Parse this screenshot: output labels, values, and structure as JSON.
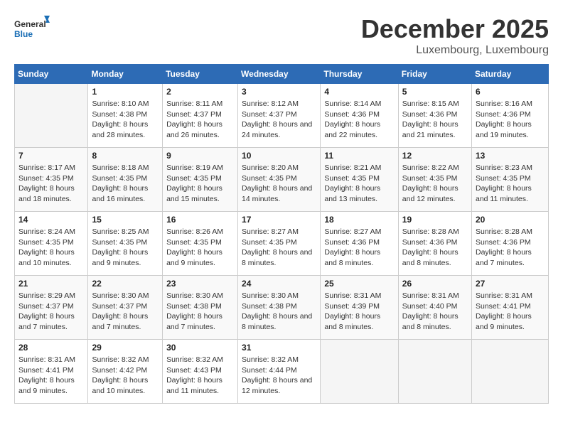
{
  "logo": {
    "line1": "General",
    "line2": "Blue"
  },
  "title": "December 2025",
  "subtitle": "Luxembourg, Luxembourg",
  "days_of_week": [
    "Sunday",
    "Monday",
    "Tuesday",
    "Wednesday",
    "Thursday",
    "Friday",
    "Saturday"
  ],
  "weeks": [
    [
      {
        "day": "",
        "sunrise": "",
        "sunset": "",
        "daylight": ""
      },
      {
        "day": "1",
        "sunrise": "Sunrise: 8:10 AM",
        "sunset": "Sunset: 4:38 PM",
        "daylight": "Daylight: 8 hours and 28 minutes."
      },
      {
        "day": "2",
        "sunrise": "Sunrise: 8:11 AM",
        "sunset": "Sunset: 4:37 PM",
        "daylight": "Daylight: 8 hours and 26 minutes."
      },
      {
        "day": "3",
        "sunrise": "Sunrise: 8:12 AM",
        "sunset": "Sunset: 4:37 PM",
        "daylight": "Daylight: 8 hours and 24 minutes."
      },
      {
        "day": "4",
        "sunrise": "Sunrise: 8:14 AM",
        "sunset": "Sunset: 4:36 PM",
        "daylight": "Daylight: 8 hours and 22 minutes."
      },
      {
        "day": "5",
        "sunrise": "Sunrise: 8:15 AM",
        "sunset": "Sunset: 4:36 PM",
        "daylight": "Daylight: 8 hours and 21 minutes."
      },
      {
        "day": "6",
        "sunrise": "Sunrise: 8:16 AM",
        "sunset": "Sunset: 4:36 PM",
        "daylight": "Daylight: 8 hours and 19 minutes."
      }
    ],
    [
      {
        "day": "7",
        "sunrise": "Sunrise: 8:17 AM",
        "sunset": "Sunset: 4:35 PM",
        "daylight": "Daylight: 8 hours and 18 minutes."
      },
      {
        "day": "8",
        "sunrise": "Sunrise: 8:18 AM",
        "sunset": "Sunset: 4:35 PM",
        "daylight": "Daylight: 8 hours and 16 minutes."
      },
      {
        "day": "9",
        "sunrise": "Sunrise: 8:19 AM",
        "sunset": "Sunset: 4:35 PM",
        "daylight": "Daylight: 8 hours and 15 minutes."
      },
      {
        "day": "10",
        "sunrise": "Sunrise: 8:20 AM",
        "sunset": "Sunset: 4:35 PM",
        "daylight": "Daylight: 8 hours and 14 minutes."
      },
      {
        "day": "11",
        "sunrise": "Sunrise: 8:21 AM",
        "sunset": "Sunset: 4:35 PM",
        "daylight": "Daylight: 8 hours and 13 minutes."
      },
      {
        "day": "12",
        "sunrise": "Sunrise: 8:22 AM",
        "sunset": "Sunset: 4:35 PM",
        "daylight": "Daylight: 8 hours and 12 minutes."
      },
      {
        "day": "13",
        "sunrise": "Sunrise: 8:23 AM",
        "sunset": "Sunset: 4:35 PM",
        "daylight": "Daylight: 8 hours and 11 minutes."
      }
    ],
    [
      {
        "day": "14",
        "sunrise": "Sunrise: 8:24 AM",
        "sunset": "Sunset: 4:35 PM",
        "daylight": "Daylight: 8 hours and 10 minutes."
      },
      {
        "day": "15",
        "sunrise": "Sunrise: 8:25 AM",
        "sunset": "Sunset: 4:35 PM",
        "daylight": "Daylight: 8 hours and 9 minutes."
      },
      {
        "day": "16",
        "sunrise": "Sunrise: 8:26 AM",
        "sunset": "Sunset: 4:35 PM",
        "daylight": "Daylight: 8 hours and 9 minutes."
      },
      {
        "day": "17",
        "sunrise": "Sunrise: 8:27 AM",
        "sunset": "Sunset: 4:35 PM",
        "daylight": "Daylight: 8 hours and 8 minutes."
      },
      {
        "day": "18",
        "sunrise": "Sunrise: 8:27 AM",
        "sunset": "Sunset: 4:36 PM",
        "daylight": "Daylight: 8 hours and 8 minutes."
      },
      {
        "day": "19",
        "sunrise": "Sunrise: 8:28 AM",
        "sunset": "Sunset: 4:36 PM",
        "daylight": "Daylight: 8 hours and 8 minutes."
      },
      {
        "day": "20",
        "sunrise": "Sunrise: 8:28 AM",
        "sunset": "Sunset: 4:36 PM",
        "daylight": "Daylight: 8 hours and 7 minutes."
      }
    ],
    [
      {
        "day": "21",
        "sunrise": "Sunrise: 8:29 AM",
        "sunset": "Sunset: 4:37 PM",
        "daylight": "Daylight: 8 hours and 7 minutes."
      },
      {
        "day": "22",
        "sunrise": "Sunrise: 8:30 AM",
        "sunset": "Sunset: 4:37 PM",
        "daylight": "Daylight: 8 hours and 7 minutes."
      },
      {
        "day": "23",
        "sunrise": "Sunrise: 8:30 AM",
        "sunset": "Sunset: 4:38 PM",
        "daylight": "Daylight: 8 hours and 7 minutes."
      },
      {
        "day": "24",
        "sunrise": "Sunrise: 8:30 AM",
        "sunset": "Sunset: 4:38 PM",
        "daylight": "Daylight: 8 hours and 8 minutes."
      },
      {
        "day": "25",
        "sunrise": "Sunrise: 8:31 AM",
        "sunset": "Sunset: 4:39 PM",
        "daylight": "Daylight: 8 hours and 8 minutes."
      },
      {
        "day": "26",
        "sunrise": "Sunrise: 8:31 AM",
        "sunset": "Sunset: 4:40 PM",
        "daylight": "Daylight: 8 hours and 8 minutes."
      },
      {
        "day": "27",
        "sunrise": "Sunrise: 8:31 AM",
        "sunset": "Sunset: 4:41 PM",
        "daylight": "Daylight: 8 hours and 9 minutes."
      }
    ],
    [
      {
        "day": "28",
        "sunrise": "Sunrise: 8:31 AM",
        "sunset": "Sunset: 4:41 PM",
        "daylight": "Daylight: 8 hours and 9 minutes."
      },
      {
        "day": "29",
        "sunrise": "Sunrise: 8:32 AM",
        "sunset": "Sunset: 4:42 PM",
        "daylight": "Daylight: 8 hours and 10 minutes."
      },
      {
        "day": "30",
        "sunrise": "Sunrise: 8:32 AM",
        "sunset": "Sunset: 4:43 PM",
        "daylight": "Daylight: 8 hours and 11 minutes."
      },
      {
        "day": "31",
        "sunrise": "Sunrise: 8:32 AM",
        "sunset": "Sunset: 4:44 PM",
        "daylight": "Daylight: 8 hours and 12 minutes."
      },
      {
        "day": "",
        "sunrise": "",
        "sunset": "",
        "daylight": ""
      },
      {
        "day": "",
        "sunrise": "",
        "sunset": "",
        "daylight": ""
      },
      {
        "day": "",
        "sunrise": "",
        "sunset": "",
        "daylight": ""
      }
    ]
  ]
}
